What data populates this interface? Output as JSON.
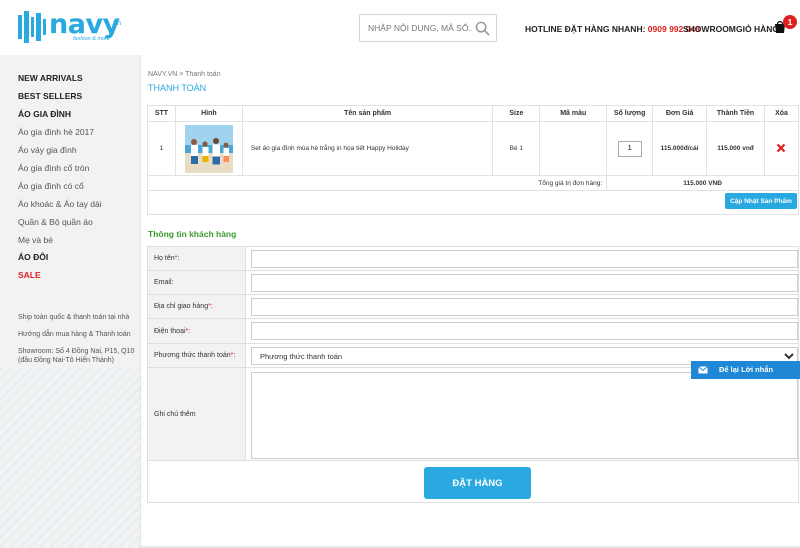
{
  "header": {
    "logo_text": "navy",
    "logo_tld": ".vn",
    "logo_tagline": "fashion & more",
    "search_placeholder": "NHẬP NỘI DUNG, MÃ SỐ...",
    "hotline_label": "HOTLINE ĐẶT HÀNG NHANH:",
    "hotline_number": "0909 992 048",
    "showroom": "SHOWROOM",
    "cart": "GIỎ HÀNG",
    "cart_count": "1",
    "icons": [
      "search-icon",
      "cart-icon"
    ]
  },
  "sidebar": {
    "items": [
      {
        "label": "NEW ARRIVALS",
        "style": "bold"
      },
      {
        "label": "BEST SELLERS",
        "style": "bold"
      },
      {
        "label": "ÁO GIA ĐÌNH",
        "style": "bold"
      },
      {
        "label": "Áo gia đình hè 2017",
        "style": "reg"
      },
      {
        "label": "Áo váy gia đình",
        "style": "reg"
      },
      {
        "label": "Áo gia đình cổ tròn",
        "style": "reg"
      },
      {
        "label": "Áo gia đình có cổ",
        "style": "reg"
      },
      {
        "label": "Áo khoác & Áo tay dài",
        "style": "reg"
      },
      {
        "label": "Quần & Bộ quần áo",
        "style": "reg"
      },
      {
        "label": "Mẹ và bé",
        "style": "reg"
      },
      {
        "label": "ÁO ĐÔI",
        "style": "bold"
      },
      {
        "label": "SALE",
        "style": "red"
      }
    ],
    "info": {
      "shipping": "Ship toàn quốc & thanh toán tại nhà",
      "guide": "Hướng dẫn mua hàng & Thanh toán",
      "showroom_line1": "Showroom: Số 4 Đồng Nai, P15, Q10",
      "showroom_line2": "(đầu Đồng Nai-Tô Hiến Thành)"
    }
  },
  "main": {
    "breadcrumb_home": "NAVY.VN",
    "breadcrumb_sep": " > ",
    "breadcrumb_current": "Thanh toán",
    "page_title": "THANH TOÁN",
    "table": {
      "headers": [
        "STT",
        "Hình",
        "Tên sản phẩm",
        "Size",
        "Mã màu",
        "Số lượng",
        "Đơn Giá",
        "Thành Tiền",
        "Xóa"
      ],
      "rows": [
        {
          "stt": "1",
          "name": "Set áo gia đình mùa hè trắng in họa tiết Happy Holiday",
          "size": "Bé 1",
          "color": "",
          "qty": "1",
          "unit_price": "115.000đ/cái",
          "subtotal": "115.000 vnđ"
        }
      ],
      "total_label": "Tổng giá trị đơn hàng:",
      "total_value": "115.000 VNĐ"
    },
    "update_button": "Cập Nhật Sản Phẩm",
    "customer_title": "Thông tin khách hàng",
    "form": {
      "name_label": "Họ tên",
      "email_label": "Email:",
      "address_label": "Địa chỉ giao hàng",
      "phone_label": "Điện thoại",
      "payment_label": "Phương thức thanh toán",
      "payment_selected": "Phương thức thanh toán",
      "note_label": "Ghi chú thêm",
      "required_mark": "*",
      "colon": ":"
    },
    "order_button": "ĐẶT HÀNG"
  },
  "chat_widget": {
    "label": "Để lại Lời nhắn",
    "icon": "mail-icon"
  },
  "colors": {
    "brand_blue": "#29a9e0",
    "price_red": "#e02020",
    "section_green": "#3a9b2e",
    "widget_blue": "#1e88d6"
  }
}
